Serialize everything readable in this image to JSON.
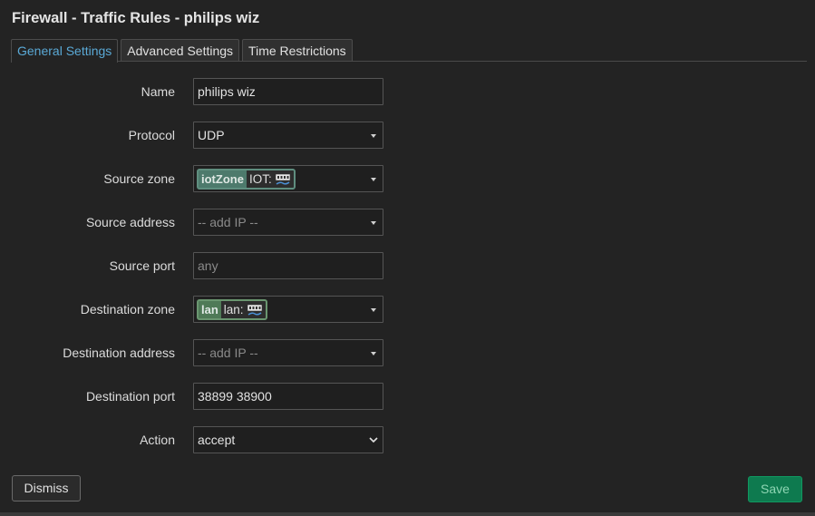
{
  "modal": {
    "title": "Firewall - Traffic Rules - philips wiz"
  },
  "tabs": [
    {
      "label": "General Settings",
      "active": true
    },
    {
      "label": "Advanced Settings",
      "active": false
    },
    {
      "label": "Time Restrictions",
      "active": false
    }
  ],
  "form": {
    "name": {
      "label": "Name",
      "value": "philips wiz"
    },
    "protocol": {
      "label": "Protocol",
      "value": "UDP"
    },
    "source_zone": {
      "label": "Source zone",
      "zone": "iotZone",
      "networks": "IOT:",
      "network_icon": "ethernet-port-icon"
    },
    "source_address": {
      "label": "Source address",
      "placeholder": "-- add IP --"
    },
    "source_port": {
      "label": "Source port",
      "placeholder": "any",
      "value": ""
    },
    "destination_zone": {
      "label": "Destination zone",
      "zone": "lan",
      "networks": "lan:",
      "network_icon": "ethernet-port-icon"
    },
    "destination_address": {
      "label": "Destination address",
      "placeholder": "-- add IP --"
    },
    "destination_port": {
      "label": "Destination port",
      "value": "38899 38900"
    },
    "action": {
      "label": "Action",
      "value": "accept"
    }
  },
  "buttons": {
    "dismiss": "Dismiss",
    "save": "Save"
  },
  "colors": {
    "background": "#232323",
    "accent_tab": "#5aa9d6",
    "iot_zone": "#4d7a6c",
    "lan_zone": "#4f7a57",
    "save": "#0e7a4f"
  }
}
